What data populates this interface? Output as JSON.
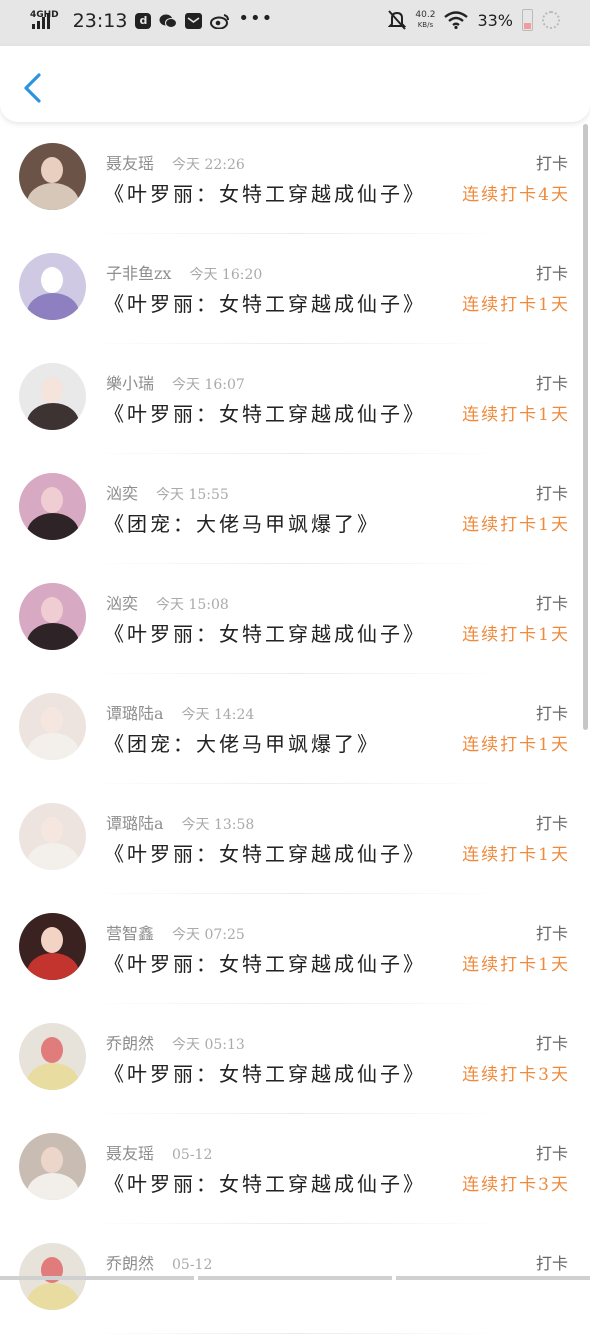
{
  "status_bar": {
    "network": "4GHD",
    "time": "23:13",
    "speed_value": "40.2",
    "speed_unit": "KB/s",
    "battery": "33%",
    "icons": [
      "signal-icon",
      "app-icon",
      "wechat-icon",
      "mail-icon",
      "weibo-icon",
      "more-dots-icon",
      "mute-icon",
      "wifi-icon",
      "battery-icon",
      "loading-icon"
    ]
  },
  "header": {
    "back_icon": "chevron-left-icon"
  },
  "colors": {
    "accent": "#2b94e0",
    "streak": "#ef8a3c",
    "name": "#8e8e8e"
  },
  "records": [
    {
      "name": "聂友瑶",
      "time": "今天 22:26",
      "tag": "打卡",
      "book": "《叶罗丽：女特工穿越成仙子》",
      "streak": "连续打卡4天"
    },
    {
      "name": "子非鱼zx",
      "time": "今天 16:20",
      "tag": "打卡",
      "book": "《叶罗丽：女特工穿越成仙子》",
      "streak": "连续打卡1天"
    },
    {
      "name": "樂小瑞",
      "time": "今天 16:07",
      "tag": "打卡",
      "book": "《叶罗丽：女特工穿越成仙子》",
      "streak": "连续打卡1天"
    },
    {
      "name": "汹奕",
      "time": "今天 15:55",
      "tag": "打卡",
      "book": "《团宠：大佬马甲飒爆了》",
      "streak": "连续打卡1天"
    },
    {
      "name": "汹奕",
      "time": "今天 15:08",
      "tag": "打卡",
      "book": "《叶罗丽：女特工穿越成仙子》",
      "streak": "连续打卡1天"
    },
    {
      "name": "谭璐陆a",
      "time": "今天 14:24",
      "tag": "打卡",
      "book": "《团宠：大佬马甲飒爆了》",
      "streak": "连续打卡1天"
    },
    {
      "name": "谭璐陆a",
      "time": "今天 13:58",
      "tag": "打卡",
      "book": "《叶罗丽：女特工穿越成仙子》",
      "streak": "连续打卡1天"
    },
    {
      "name": "营智鑫",
      "time": "今天 07:25",
      "tag": "打卡",
      "book": "《叶罗丽：女特工穿越成仙子》",
      "streak": "连续打卡1天"
    },
    {
      "name": "乔朗然",
      "time": "今天 05:13",
      "tag": "打卡",
      "book": "《叶罗丽：女特工穿越成仙子》",
      "streak": "连续打卡3天"
    },
    {
      "name": "聂友瑶",
      "time": "05-12",
      "tag": "打卡",
      "book": "《叶罗丽：女特工穿越成仙子》",
      "streak": "连续打卡3天"
    },
    {
      "name": "乔朗然",
      "time": "05-12",
      "tag": "打卡",
      "book": "",
      "streak": ""
    }
  ]
}
